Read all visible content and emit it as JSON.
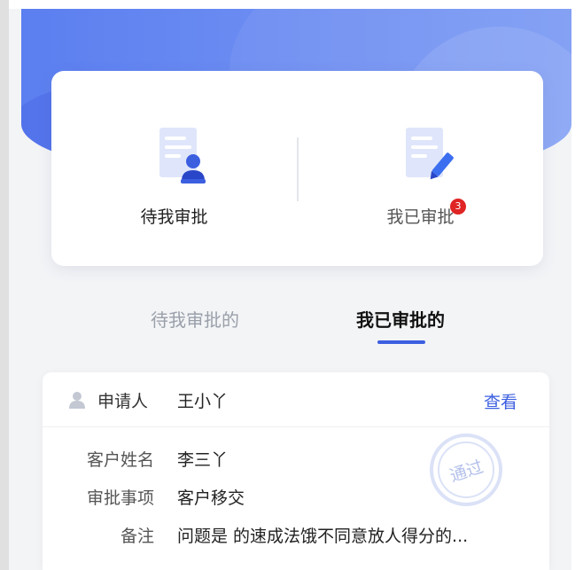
{
  "cards": {
    "pending": {
      "label": "待我审批"
    },
    "approved": {
      "label": "我已审批",
      "badge_count": "3"
    }
  },
  "tabs": {
    "pending_label": "待我审批的",
    "done_label": "我已审批的",
    "active": "done"
  },
  "record": {
    "applicant_label": "申请人",
    "applicant_name": "王小丫",
    "view_label": "查看",
    "fields": [
      {
        "label": "客户姓名",
        "value": "李三丫"
      },
      {
        "label": "审批事项",
        "value": "客户移交"
      },
      {
        "label": "备注",
        "value": "问题是 的速成法饿不同意放人得分的..."
      }
    ],
    "stamp_text": "通过"
  },
  "colors": {
    "brand_blue": "#3c5fe0",
    "hero_blue": "#6f8ff2",
    "badge_red": "#e02424"
  },
  "icons": {
    "pending_card": "document-user-icon",
    "approved_card": "document-pen-icon",
    "applicant": "person-icon",
    "stamp": "approved-stamp-icon"
  }
}
